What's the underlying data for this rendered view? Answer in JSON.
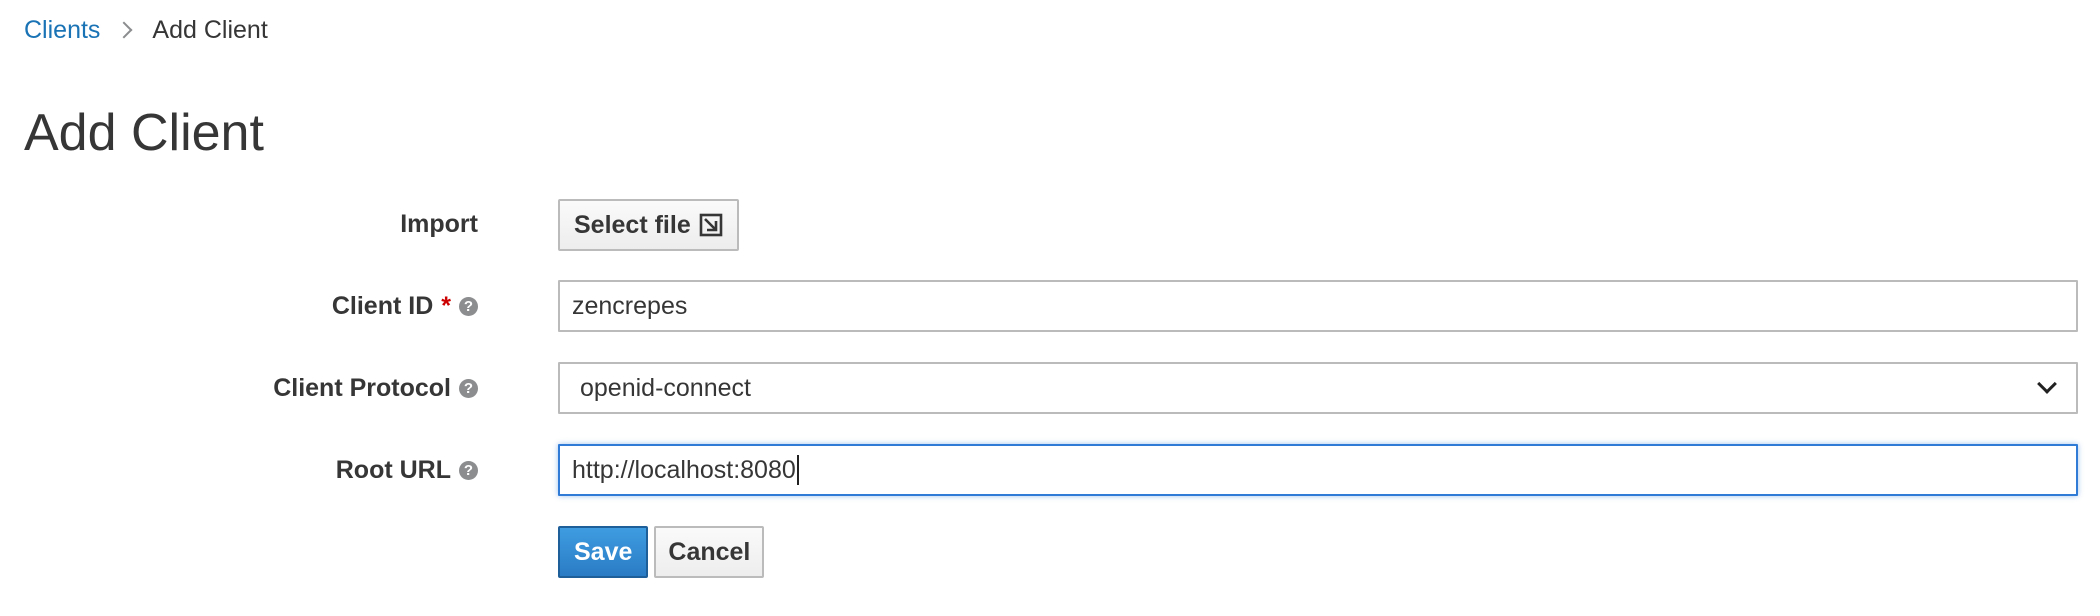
{
  "breadcrumb": {
    "parent": "Clients",
    "current": "Add Client"
  },
  "page": {
    "title": "Add Client"
  },
  "form": {
    "import": {
      "label": "Import",
      "button_label": "Select file"
    },
    "client_id": {
      "label": "Client ID",
      "required_mark": "*",
      "value": "zencrepes"
    },
    "client_protocol": {
      "label": "Client Protocol",
      "selected": "openid-connect"
    },
    "root_url": {
      "label": "Root URL",
      "value": "http://localhost:8080"
    },
    "help_glyph": "?"
  },
  "actions": {
    "save_label": "Save",
    "cancel_label": "Cancel"
  },
  "colors": {
    "link": "#1a73b5",
    "primary": "#2a7cc4",
    "required": "#cc0000",
    "focus": "#2f7bd6"
  },
  "icons": {
    "import": "import-file-icon",
    "help": "question-circle-icon",
    "breadcrumb_separator": "chevron-right-icon",
    "select": "chevron-down-icon"
  }
}
